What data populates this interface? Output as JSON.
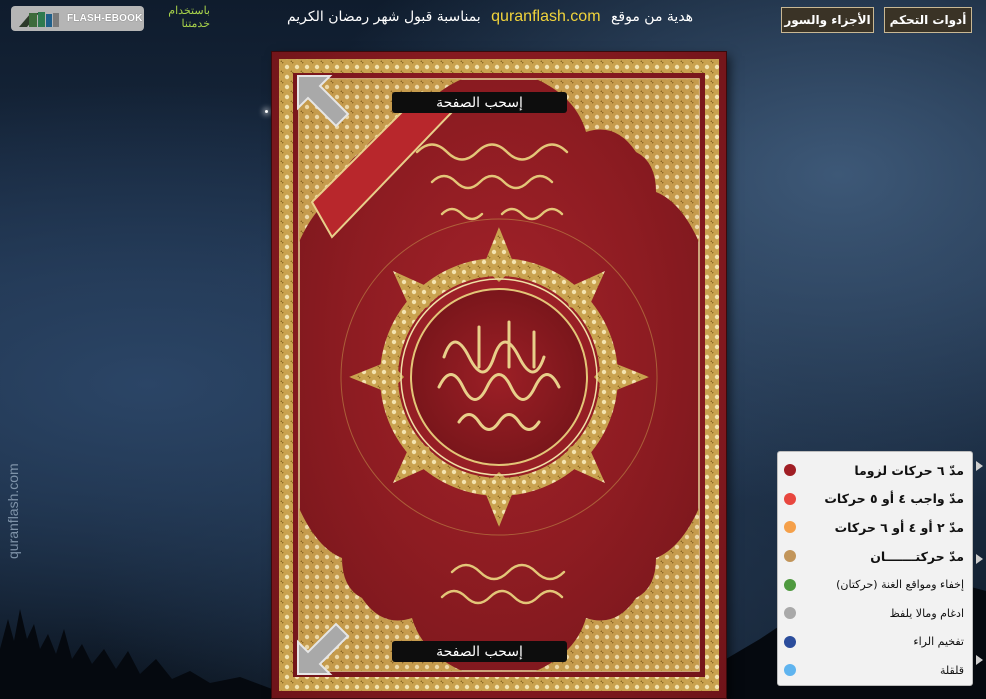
{
  "branding": {
    "logo_text": "FLASH-EBOOK",
    "powered_line1": "باستخدام",
    "powered_line2": "خدمتنا",
    "side_watermark": "quranflash.com"
  },
  "header": {
    "message_before": "هدية من موقع",
    "site": "quranflash.com",
    "message_after": "بمناسبة قبول شهر رمضان الكريم",
    "btn_parts": "الأجزاء والسور",
    "btn_controls": "أدوات التحكم"
  },
  "book": {
    "drag_top": "إسحب الصفحة",
    "drag_bottom": "إسحب الصفحة"
  },
  "legend": {
    "items": [
      {
        "label": "مدّ ٦ حركات لزوما",
        "color": "#a01e24"
      },
      {
        "label": "مدّ واجب ٤ أو ٥ حركات",
        "color": "#e8473f"
      },
      {
        "label": "مدّ ٢ أو ٤ أو ٦ حركات",
        "color": "#f5a04a"
      },
      {
        "label": "مدّ حركتـــــــان",
        "color": "#c2955a"
      },
      {
        "label": "إخفاء ومواقع الغنة (حركتان)",
        "color": "#4f9a3f"
      },
      {
        "label": "ادغام وماﻻ يلفظ",
        "color": "#a9a9a9"
      },
      {
        "label": "تفخيم الراء",
        "color": "#2b4d9c"
      },
      {
        "label": "قلقلة",
        "color": "#5fb4ef"
      }
    ]
  }
}
